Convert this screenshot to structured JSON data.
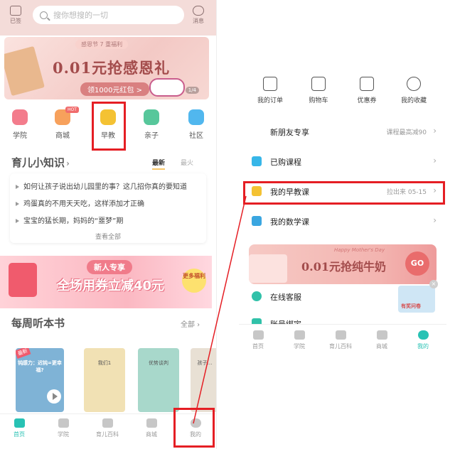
{
  "left": {
    "topbar": {
      "sign_label": "已签",
      "search_placeholder": "搜你想搜的一切",
      "message_label": "消息"
    },
    "banner": {
      "tag": "感恩节 7 重福利",
      "main": "0.01元抢感恩礼",
      "sub": "领1000元红包 >",
      "page": "1/4"
    },
    "nav": [
      {
        "label": "学院",
        "color": "#f37c8c"
      },
      {
        "label": "商城",
        "color": "#f7a15c"
      },
      {
        "label": "早教",
        "color": "#f4c233"
      },
      {
        "label": "亲子",
        "color": "#57c79b"
      },
      {
        "label": "社区",
        "color": "#51b7ee"
      }
    ],
    "nav_hot_badge": "HOT",
    "knowledge": {
      "title": "育儿小知识",
      "arrow": "›",
      "tab_new": "最新",
      "tab_hot": "最火",
      "items": [
        "如何让孩子说出幼儿园里的事？这几招你真的要知道",
        "鸡蛋真的不用天天吃，这样添加才正确",
        "宝宝的猛长期，妈妈的“噩梦”期"
      ],
      "see_all": "查看全部"
    },
    "promo": {
      "title": "新人专享",
      "main": "全场用券立减40元",
      "side": "更多福利"
    },
    "books": {
      "title": "每周听本书",
      "all_label": "全部 ›",
      "items": [
        {
          "label": "钝感力：迟钝=更幸福?",
          "tag": "最新",
          "color": "#7fb3d6"
        },
        {
          "label": "我们1",
          "color": "#f1e1b4"
        },
        {
          "label": "优势谈判",
          "color": "#a8d8cb"
        },
        {
          "label": "孩子…",
          "color": "#e8e0d4"
        }
      ]
    },
    "tabbar": [
      {
        "label": "首页",
        "active": true
      },
      {
        "label": "学院",
        "active": false
      },
      {
        "label": "育儿百科",
        "active": false
      },
      {
        "label": "商城",
        "active": false
      },
      {
        "label": "我的",
        "active": false
      }
    ]
  },
  "right": {
    "quick": [
      {
        "label": "我的订单",
        "icon": "orders-icon"
      },
      {
        "label": "购物车",
        "icon": "cart-icon"
      },
      {
        "label": "优惠券",
        "icon": "coupon-icon"
      },
      {
        "label": "我的收藏",
        "icon": "star-icon"
      }
    ],
    "rows": [
      {
        "label": "新朋友专享",
        "right": "课程最高减90",
        "icon_color": ""
      },
      {
        "label": "已购课程",
        "right": "",
        "icon_color": "#37b6e8"
      },
      {
        "label": "我的早教课",
        "right": "拉出来 05-15",
        "icon_color": "#f4c233"
      },
      {
        "label": "我的数学课",
        "right": "",
        "icon_color": "#3aa6e0"
      }
    ],
    "banner": {
      "small": "Happy Mother's Day",
      "main": "0.01元抢纯牛奶",
      "go": "GO"
    },
    "service_rows": [
      {
        "label": "在线客服",
        "icon_color": "#31c1a9"
      },
      {
        "label": "账号绑定",
        "icon_color": "#31c1a9"
      }
    ],
    "prize_label": "有奖问卷",
    "prize_close": "×",
    "tabbar": [
      {
        "label": "首页",
        "active": false
      },
      {
        "label": "学院",
        "active": false
      },
      {
        "label": "育儿百科",
        "active": false
      },
      {
        "label": "商城",
        "active": false
      },
      {
        "label": "我的",
        "active": true
      }
    ]
  },
  "colors": {
    "highlight": "#e51e24",
    "accent": "#28c2b4"
  }
}
